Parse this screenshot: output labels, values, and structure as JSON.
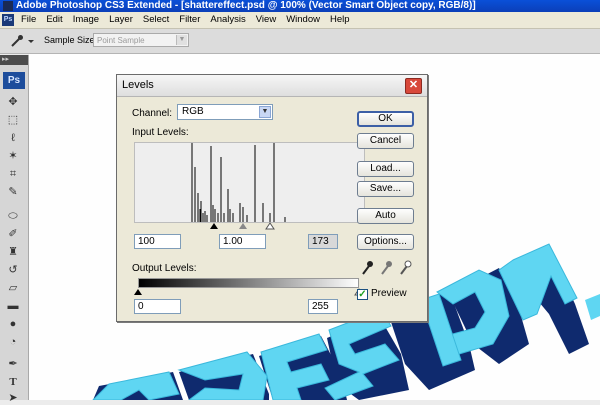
{
  "app": {
    "title": "Adobe Photoshop CS3 Extended - [shattereffect.psd @ 100% (Vector Smart Object copy, RGB/8)]",
    "icon_label": "Ps"
  },
  "menu": [
    "File",
    "Edit",
    "Image",
    "Layer",
    "Select",
    "Filter",
    "Analysis",
    "View",
    "Window",
    "Help"
  ],
  "options_bar": {
    "sample_size_label": "Sample Size:",
    "sample_size_value": "Point Sample",
    "tool_icon": "eyedropper-icon"
  },
  "toolbox": {
    "logo": "Ps",
    "tools": [
      "move-icon",
      "marquee-icon",
      "lasso-icon",
      "magic-wand-icon",
      "crop-icon",
      "eyedropper-icon",
      "healing-icon",
      "brush-icon",
      "clone-stamp-icon",
      "history-brush-icon",
      "eraser-icon",
      "gradient-icon",
      "blur-icon",
      "dodge-icon",
      "pen-icon",
      "type-icon",
      "path-selection-icon",
      "shape-icon"
    ]
  },
  "canvas": {
    "text": "DESIGN",
    "face_color": "#5fd6f2",
    "side_color": "#0f2a6e"
  },
  "levels_dialog": {
    "title": "Levels",
    "channel_label": "Channel:",
    "channel_value": "RGB",
    "input_levels_label": "Input Levels:",
    "input_black": "100",
    "input_gamma": "1.00",
    "input_white": "173",
    "output_levels_label": "Output Levels:",
    "output_black": "0",
    "output_white": "255",
    "buttons": {
      "ok": "OK",
      "cancel": "Cancel",
      "load": "Load...",
      "save": "Save...",
      "auto": "Auto",
      "options": "Options..."
    },
    "preview_label": "Preview",
    "preview_checked": true
  }
}
